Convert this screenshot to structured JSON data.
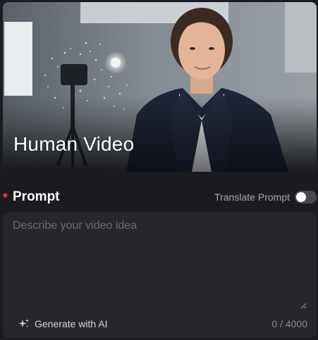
{
  "hero": {
    "title": "Human Video",
    "image_icon": "photo-presenter-in-studio"
  },
  "prompt": {
    "required_mark": "*",
    "label": "Prompt",
    "translate_label": "Translate Prompt",
    "translate_enabled": false,
    "placeholder": "Describe your video idea",
    "value": "",
    "generate_label": "Generate with AI",
    "generate_icon": "sparkle-icon",
    "char_count": "0 / 4000"
  },
  "colors": {
    "background": "#1c1c20",
    "input_background": "#26262b",
    "required": "#e5484d",
    "toggle_off": "#4a4a50"
  }
}
